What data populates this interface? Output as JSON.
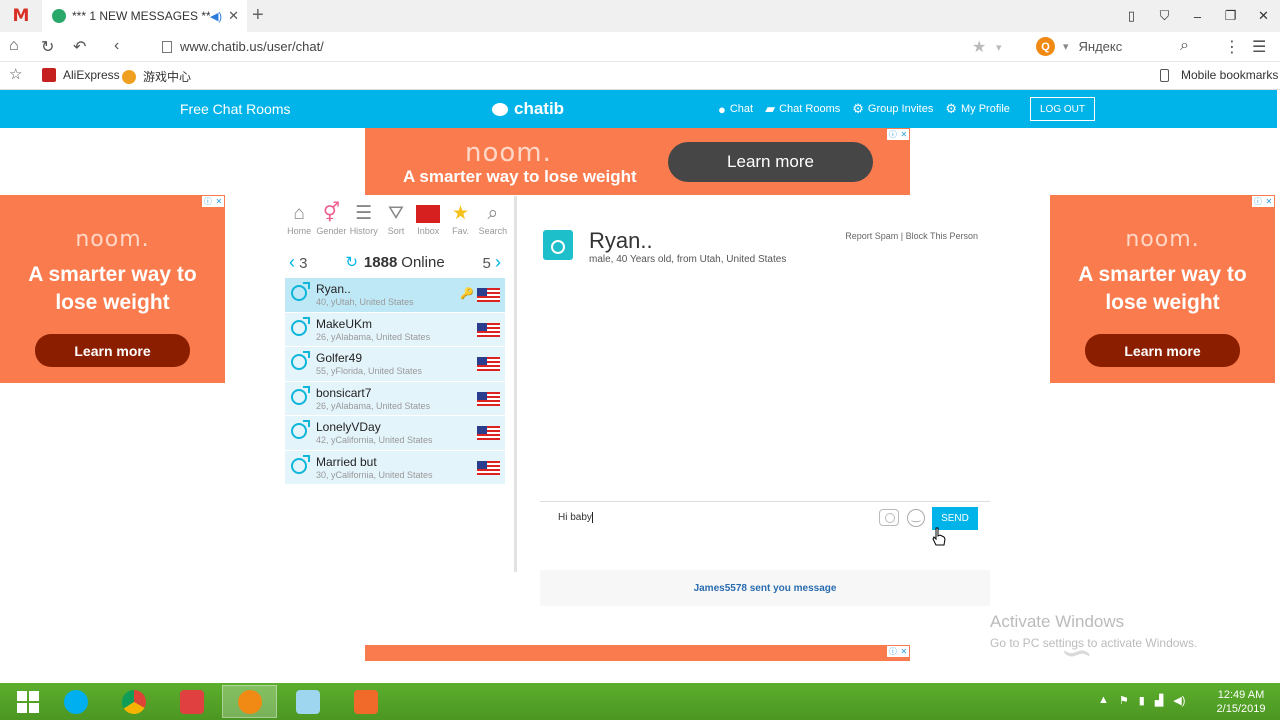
{
  "browser": {
    "active_tab_title": "*** 1 NEW MESSAGES ***",
    "url": "www.chatib.us/user/chat/",
    "search_engine": "Яндекс",
    "bookmarks": [
      "AliExpress",
      "游戏中心"
    ],
    "mobile_bookmarks": "Mobile bookmarks"
  },
  "site": {
    "brand_color": "#00b4ea",
    "free_chat": "Free Chat Rooms",
    "logo": "chatib",
    "menu": [
      "Chat",
      "Chat Rooms",
      "Group Invites",
      "My Profile"
    ],
    "logout": "LOG OUT"
  },
  "ads": {
    "brand": "noom.",
    "tagline": "A smarter way to lose weight",
    "cta": "Learn more",
    "color": "#fa7c4e"
  },
  "toolbar": {
    "items": [
      "Home",
      "Gender",
      "History",
      "Sort",
      "Inbox",
      "Fav.",
      "Search"
    ]
  },
  "pager": {
    "prev": "3",
    "next": "5",
    "online_count": "1888",
    "online_label": "Online"
  },
  "users": [
    {
      "name": "Ryan..",
      "detail": "40, yUtah, United States",
      "selected": true
    },
    {
      "name": "MakeUKm",
      "detail": "26, yAlabama, United States"
    },
    {
      "name": "Golfer49",
      "detail": "55, yFlorida, United States"
    },
    {
      "name": "bonsicart7",
      "detail": "26, yAlabama, United States"
    },
    {
      "name": "LonelyVDay",
      "detail": "42, yCalifornia, United States"
    },
    {
      "name": "Married but",
      "detail": "30, yCalifornia, United States"
    }
  ],
  "chat": {
    "name": "Ryan..",
    "subtitle": "male, 40 Years old, from Utah, United States",
    "report_spam": "Report Spam",
    "block": "Block This Person",
    "input_value": "Hi baby",
    "send": "SEND",
    "notification": "James5578 sent you message"
  },
  "watermark": {
    "activate_title": "Activate Windows",
    "activate_sub": "Go to PC settings to activate Windows."
  },
  "taskbar": {
    "time": "12:49 AM",
    "date": "2/15/2019"
  }
}
